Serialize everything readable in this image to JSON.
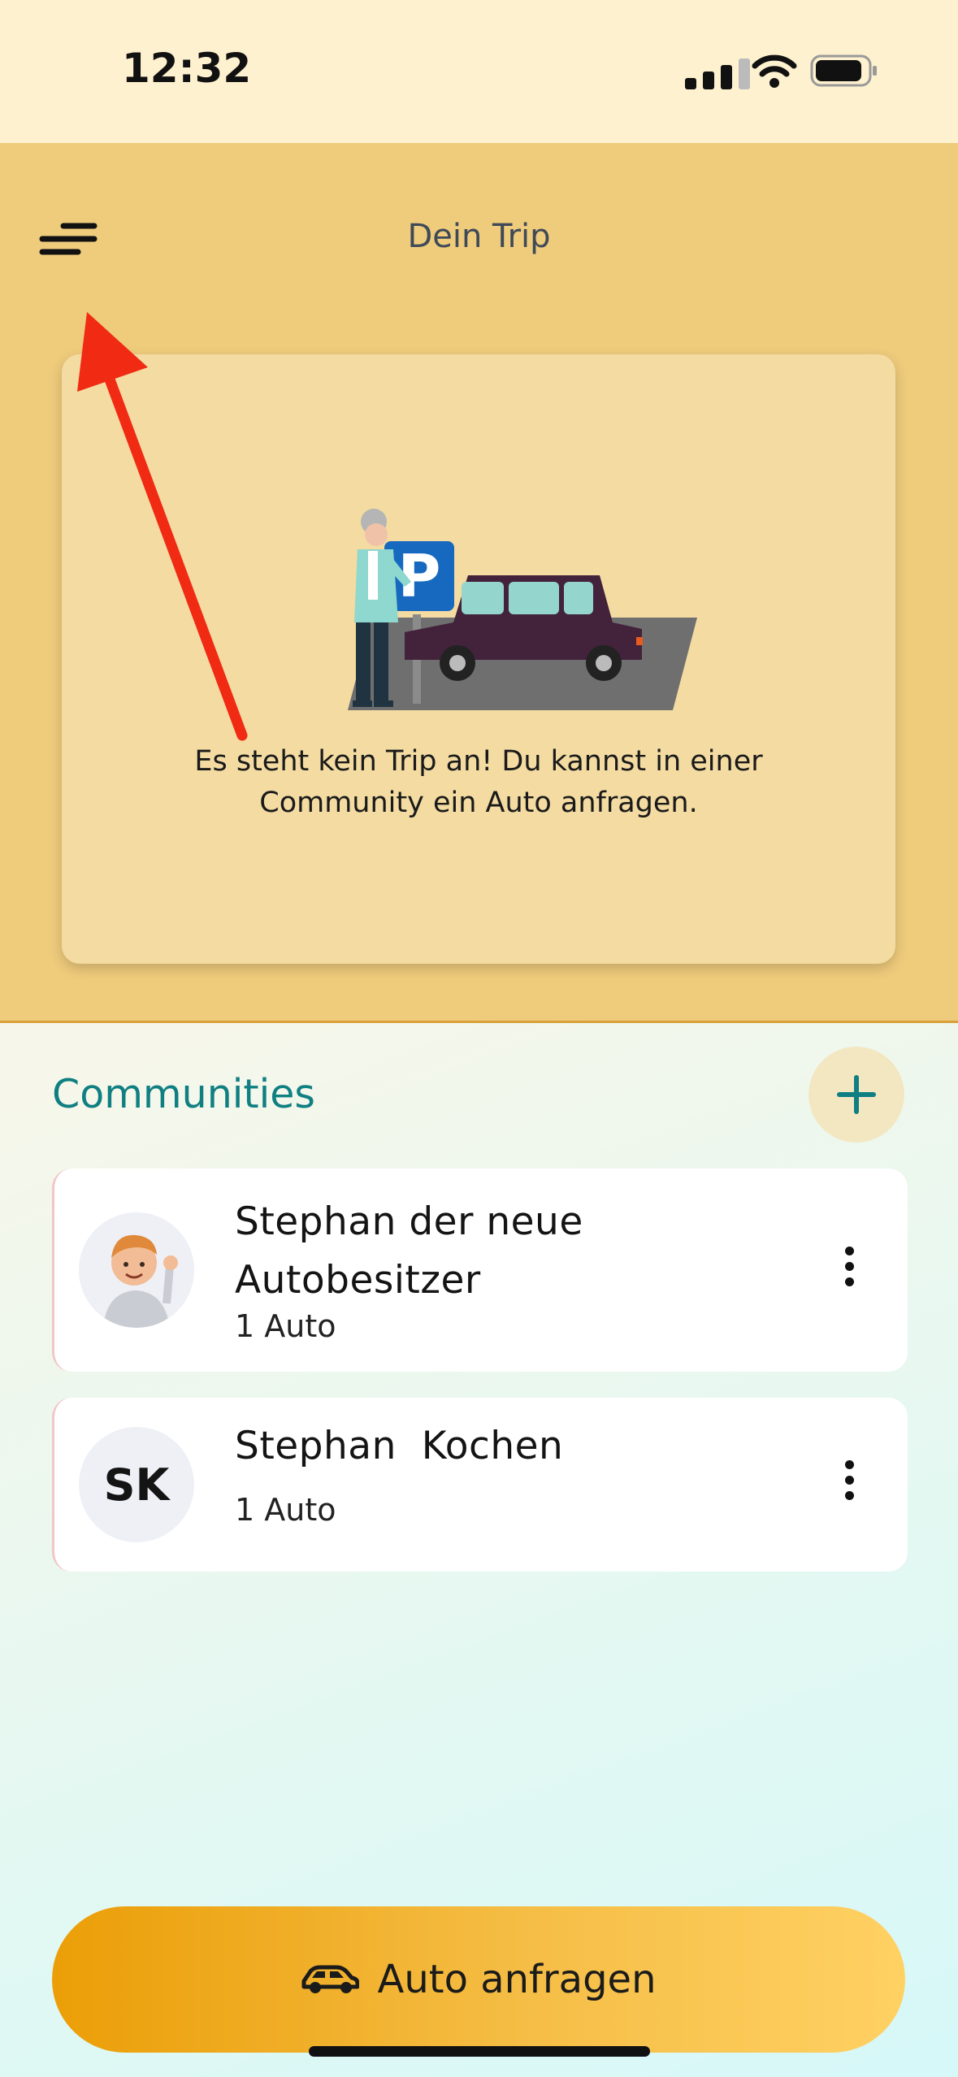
{
  "status_bar": {
    "time": "12:32"
  },
  "header": {
    "title": "Dein Trip"
  },
  "trip_card": {
    "empty_message": "Es steht kein Trip an! Du kannst in einer Community ein Auto anfragen."
  },
  "communities": {
    "title": "Communities",
    "items": [
      {
        "name": "Stephan der neue Autobesitzer",
        "subtitle": "1 Auto",
        "avatar": "memoji-avatar"
      },
      {
        "name": "Stephan  Kochen",
        "subtitle": "1 Auto",
        "initials": "SK"
      }
    ]
  },
  "cta": {
    "label": "Auto anfragen",
    "icon": "car-icon"
  },
  "colors": {
    "accent": "#0f7f82",
    "header_bg": "#efcb7c",
    "cta_start": "#eb9e07",
    "cta_end": "#ffd163"
  }
}
